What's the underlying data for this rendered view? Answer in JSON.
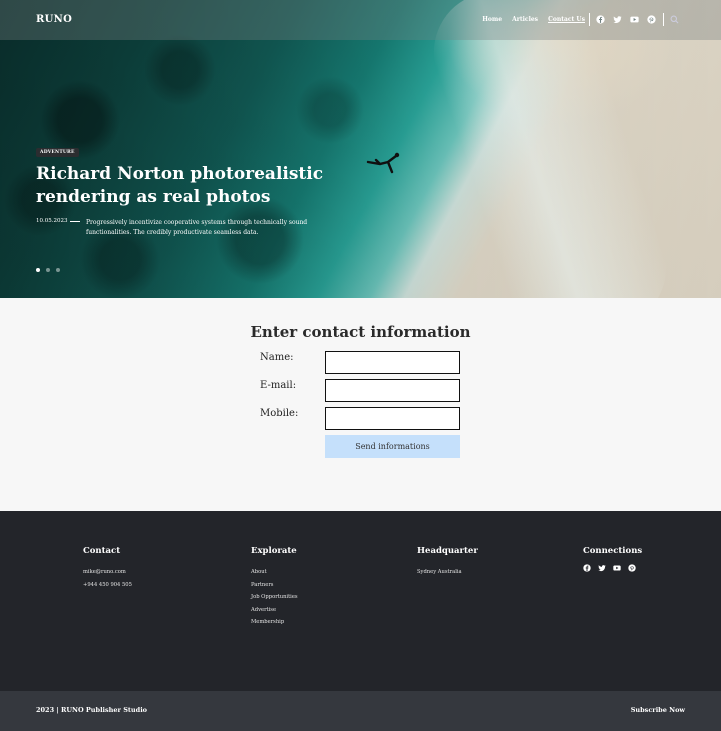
{
  "header": {
    "logo": "RUNO",
    "nav": [
      "Home",
      "Articles",
      "Contact Us"
    ],
    "active_nav": "Contact Us",
    "social_icons": [
      "facebook-icon",
      "twitter-icon",
      "youtube-icon",
      "pinterest-icon"
    ],
    "search_icon": "search-icon"
  },
  "hero": {
    "badge": "ADVENTURE",
    "title": "Richard Norton photorealistic rendering as real photos",
    "date": "10.05.2023",
    "description": "Progressively incentivize cooperative systems through technically sound functionalities. The credibly productivate seamless data.",
    "slide_count": 3,
    "active_slide": 1
  },
  "contact_form": {
    "title": "Enter contact information",
    "fields": [
      {
        "label": "Name:",
        "value": ""
      },
      {
        "label": "E-mail:",
        "value": ""
      },
      {
        "label": "Mobile:",
        "value": ""
      }
    ],
    "submit_label": "Send informations",
    "submit_color": "#c5e0fb"
  },
  "footer": {
    "contact": {
      "heading": "Contact",
      "email": "mike@runo.com",
      "phone": "+944 450 904 505"
    },
    "explore": {
      "heading": "Explorate",
      "links": [
        "About",
        "Partners",
        "Job Opportunities",
        "Advertise",
        "Membership"
      ]
    },
    "headquarter": {
      "heading": "Headquarter",
      "location": "Sydney Australia"
    },
    "connections": {
      "heading": "Connections",
      "icons": [
        "facebook-icon",
        "twitter-icon",
        "youtube-icon",
        "pinterest-icon"
      ]
    },
    "copyright": "2023 | RUNO Publisher Studio",
    "subscribe": "Subscribe Now",
    "background": "#23252a",
    "bottom_bar_background": "#35383e"
  }
}
